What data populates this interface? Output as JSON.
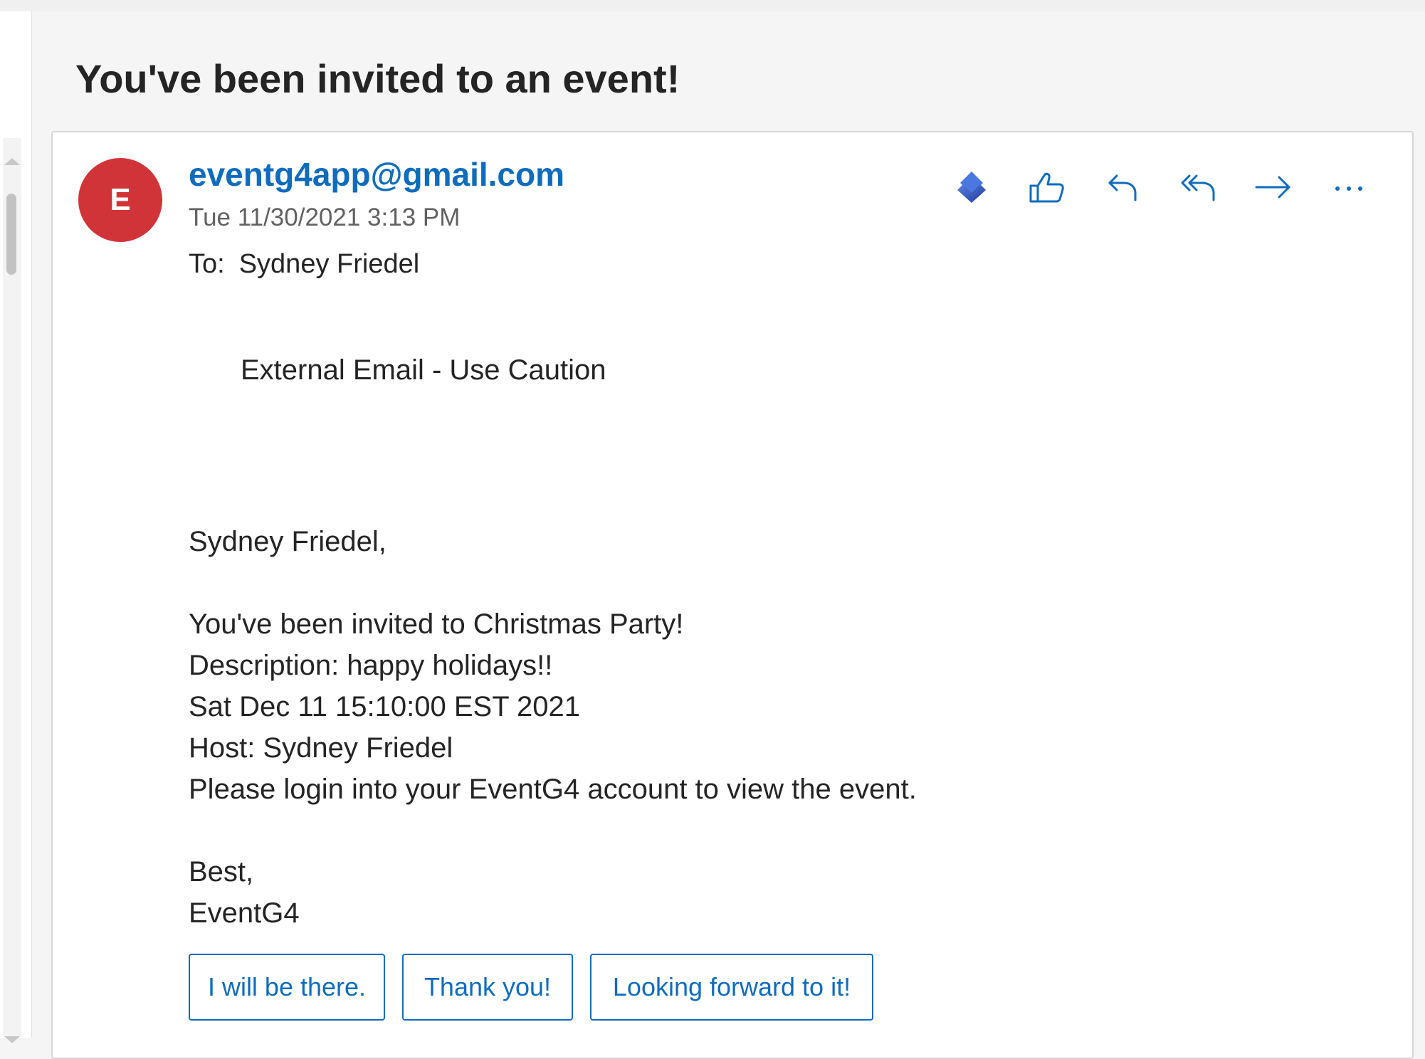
{
  "subject": "You've been invited to an event!",
  "message": {
    "avatar_initial": "E",
    "avatar_color": "#d13438",
    "sender": "eventg4app@gmail.com",
    "date": "Tue 11/30/2021 3:13 PM",
    "to_label": "To:",
    "to_name": "Sydney Friedel",
    "caution": "External Email - Use Caution",
    "body": {
      "greeting": "Sydney Friedel,",
      "line1": "You've been invited to Christmas Party!",
      "line2": "Description: happy holidays!!",
      "line3": "Sat Dec 11 15:10:00 EST 2021",
      "line4": "Host: Sydney Friedel",
      "line5": "Please login into your EventG4 account to view the event.",
      "signoff": "Best,",
      "signature": "EventG4"
    }
  },
  "actions": {
    "icons": [
      "copilot-icon",
      "like-icon",
      "reply-icon",
      "reply-all-icon",
      "forward-icon",
      "more-icon"
    ]
  },
  "quick_replies": [
    "I will be there.",
    "Thank you!",
    "Looking forward to it!"
  ],
  "colors": {
    "accent": "#0f6cbd",
    "avatar": "#d13438"
  }
}
